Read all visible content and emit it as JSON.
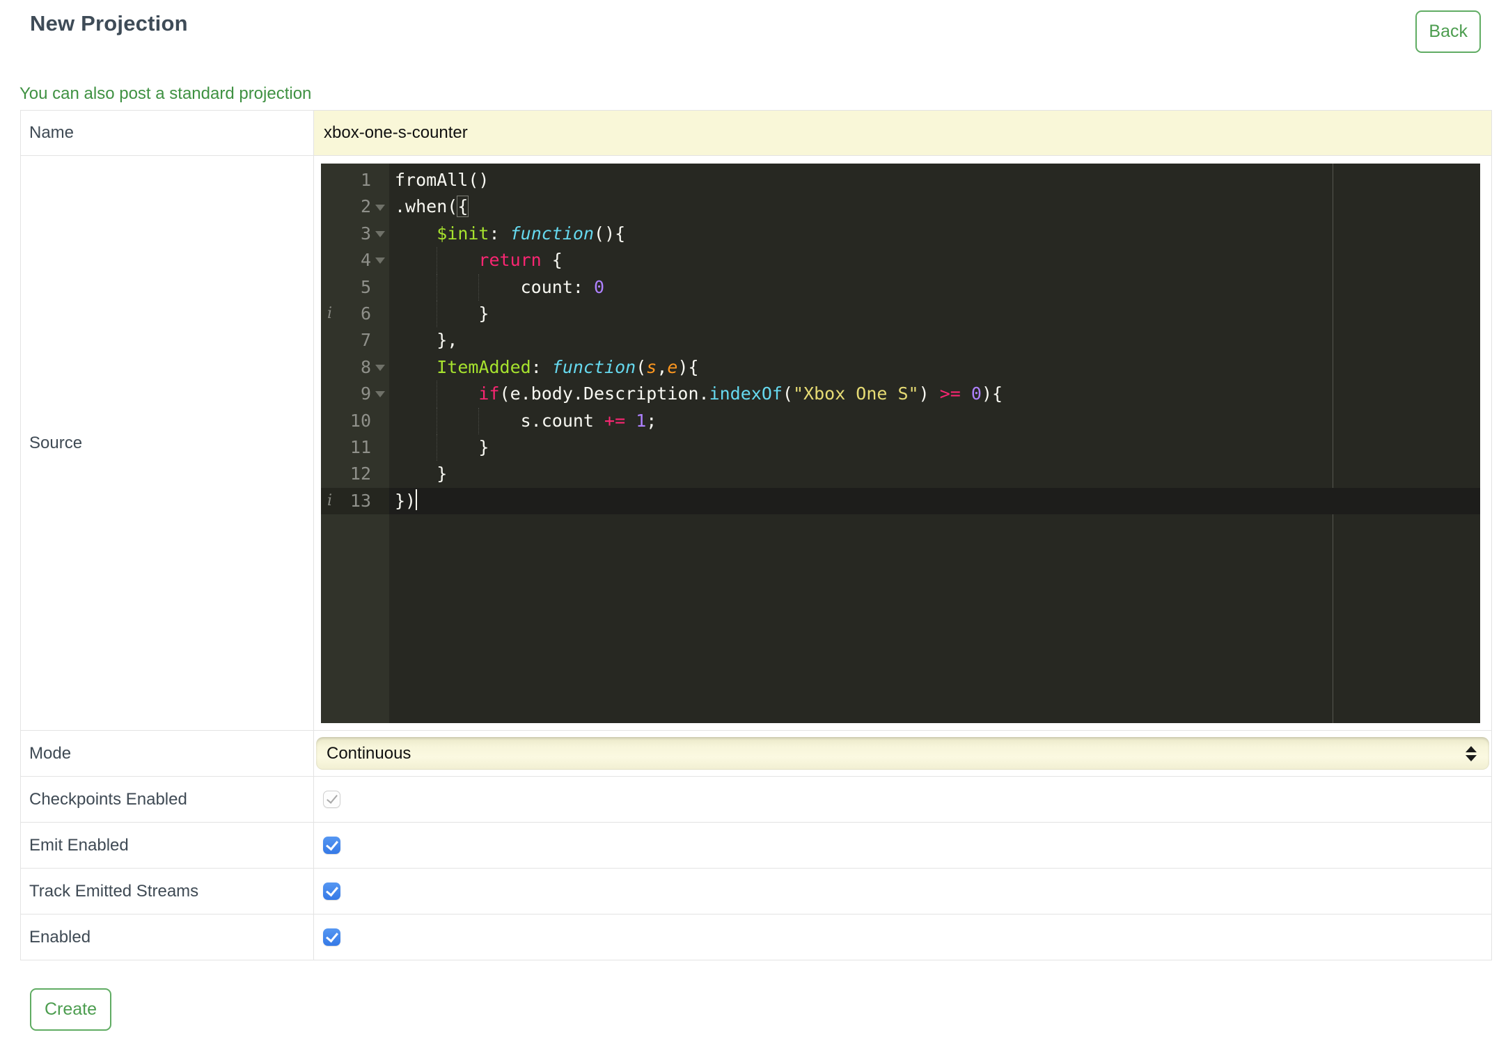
{
  "header": {
    "title": "New Projection",
    "back_label": "Back"
  },
  "note": {
    "text": "You can also post a standard projection"
  },
  "form": {
    "name": {
      "label": "Name",
      "value": "xbox-one-s-counter"
    },
    "source": {
      "label": "Source"
    },
    "mode": {
      "label": "Mode",
      "value": "Continuous"
    },
    "toggles": [
      {
        "label": "Checkpoints Enabled",
        "checked": true,
        "disabled": true
      },
      {
        "label": "Emit Enabled",
        "checked": true,
        "disabled": false
      },
      {
        "label": "Track Emitted Streams",
        "checked": true,
        "disabled": false
      },
      {
        "label": "Enabled",
        "checked": true,
        "disabled": false
      }
    ],
    "create_label": "Create"
  },
  "colors": {
    "accent_green_text": "#3f9142",
    "accent_green_border": "#60ac63",
    "title_text": "#3e4b57",
    "input_yellow": "#f9f7d8",
    "checkbox_blue": "#3d7fe8",
    "editor_bg": "#272822",
    "editor_gutter": "#31332a",
    "tok_keyword": "#f92672",
    "tok_entity": "#a6e22e",
    "tok_storage": "#66d9ef",
    "tok_string": "#e6db74",
    "tok_number": "#ae81ff",
    "tok_param": "#fd971f"
  },
  "editor": {
    "lines": [
      {
        "n": 1,
        "tokens": [
          [
            "plain",
            "fromAll()"
          ]
        ]
      },
      {
        "n": 2,
        "fold": true,
        "tokens": [
          [
            "plain",
            ".when("
          ],
          [
            "brhl",
            "{"
          ]
        ]
      },
      {
        "n": 3,
        "fold": true,
        "tokens": [
          [
            "plain",
            "    "
          ],
          [
            "entity",
            "$init"
          ],
          [
            "plain",
            ": "
          ],
          [
            "storage",
            "function"
          ],
          [
            "plain",
            "(){"
          ]
        ]
      },
      {
        "n": 4,
        "fold": true,
        "guides": [
          4
        ],
        "tokens": [
          [
            "plain",
            "        "
          ],
          [
            "keyword",
            "return"
          ],
          [
            "plain",
            " {"
          ]
        ]
      },
      {
        "n": 5,
        "guides": [
          4,
          8
        ],
        "tokens": [
          [
            "plain",
            "            count: "
          ],
          [
            "number",
            "0"
          ]
        ]
      },
      {
        "n": 6,
        "info": true,
        "guides": [
          4
        ],
        "tokens": [
          [
            "plain",
            "        }"
          ]
        ]
      },
      {
        "n": 7,
        "tokens": [
          [
            "plain",
            "    },"
          ]
        ]
      },
      {
        "n": 8,
        "fold": true,
        "tokens": [
          [
            "plain",
            "    "
          ],
          [
            "entity",
            "ItemAdded"
          ],
          [
            "plain",
            ": "
          ],
          [
            "storage",
            "function"
          ],
          [
            "plain",
            "("
          ],
          [
            "param",
            "s"
          ],
          [
            "plain",
            ","
          ],
          [
            "param",
            "e"
          ],
          [
            "plain",
            "){"
          ]
        ]
      },
      {
        "n": 9,
        "fold": true,
        "guides": [
          4
        ],
        "tokens": [
          [
            "plain",
            "        "
          ],
          [
            "keyword",
            "if"
          ],
          [
            "plain",
            "(e.body.Description."
          ],
          [
            "support",
            "indexOf"
          ],
          [
            "plain",
            "("
          ],
          [
            "string",
            "\"Xbox One S\""
          ],
          [
            "plain",
            ") "
          ],
          [
            "keyword",
            ">="
          ],
          [
            "plain",
            " "
          ],
          [
            "number",
            "0"
          ],
          [
            "plain",
            "){"
          ]
        ]
      },
      {
        "n": 10,
        "guides": [
          4,
          8
        ],
        "tokens": [
          [
            "plain",
            "            s.count "
          ],
          [
            "keyword",
            "+="
          ],
          [
            "plain",
            " "
          ],
          [
            "number",
            "1"
          ],
          [
            "plain",
            ";"
          ]
        ]
      },
      {
        "n": 11,
        "guides": [
          4
        ],
        "tokens": [
          [
            "plain",
            "        }"
          ]
        ]
      },
      {
        "n": 12,
        "tokens": [
          [
            "plain",
            "    }"
          ]
        ]
      },
      {
        "n": 13,
        "info": true,
        "active": true,
        "cursor": true,
        "tokens": [
          [
            "plain",
            "})"
          ]
        ]
      }
    ]
  }
}
